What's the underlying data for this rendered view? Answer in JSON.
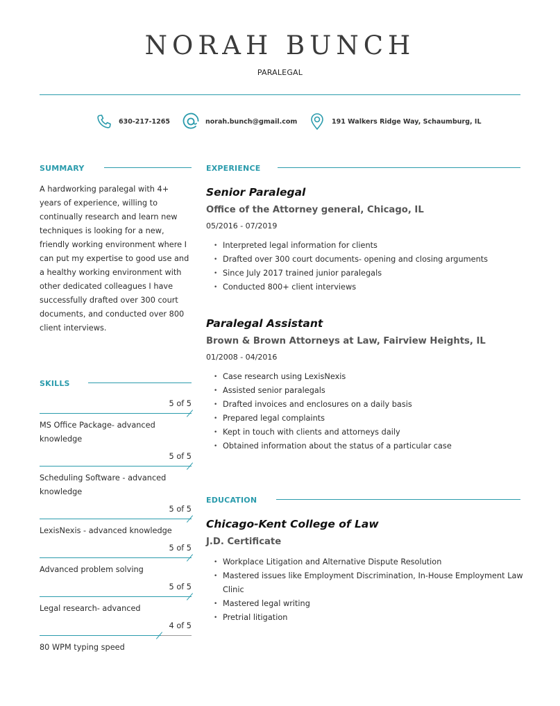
{
  "header": {
    "name": "NORAH BUNCH",
    "title": "PARALEGAL"
  },
  "contact": {
    "phone": {
      "icon": "phone-icon",
      "text": "630-217-1265"
    },
    "email": {
      "icon": "at-sign-icon",
      "text": "norah.bunch@gmail.com"
    },
    "address": {
      "icon": "map-pin-icon",
      "text": "191 Walkers Ridge Way, Schaumburg, IL"
    }
  },
  "colors": {
    "accent": "#2a9bac",
    "text": "#2b2b2b",
    "subtle": "#555555"
  },
  "summary": {
    "heading": "SUMMARY",
    "text": "A hardworking paralegal with 4+ years of experience, willing to continually research and learn new techniques is looking for a new, friendly working environment where I can put my expertise to good use and a healthy working environment with other dedicated colleagues I have successfully drafted over 300 court documents, and conducted over 800 client interviews."
  },
  "skills": {
    "heading": "SKILLS",
    "items": [
      {
        "level_label": "5 of 5",
        "level": 5,
        "max": 5,
        "name": "MS Office Package- advanced knowledge"
      },
      {
        "level_label": "5 of 5",
        "level": 5,
        "max": 5,
        "name": "Scheduling Software - advanced knowledge"
      },
      {
        "level_label": "5 of 5",
        "level": 5,
        "max": 5,
        "name": "LexisNexis - advanced knowledge"
      },
      {
        "level_label": "5 of 5",
        "level": 5,
        "max": 5,
        "name": "Advanced problem solving"
      },
      {
        "level_label": "5 of 5",
        "level": 5,
        "max": 5,
        "name": "Legal research- advanced"
      },
      {
        "level_label": "4 of 5",
        "level": 4,
        "max": 5,
        "name": "80 WPM typing speed"
      }
    ]
  },
  "experience": {
    "heading": "EXPERIENCE",
    "jobs": [
      {
        "title": "Senior Paralegal",
        "org": "Office of the Attorney general, Chicago, IL",
        "dates": "05/2016 - 07/2019",
        "bullets": [
          "Interpreted legal information for clients",
          "Drafted over 300 court documents- opening and closing arguments",
          "Since July 2017 trained junior paralegals",
          "Conducted 800+ client interviews"
        ]
      },
      {
        "title": "Paralegal Assistant",
        "org": "Brown & Brown Attorneys at Law, Fairview Heights, IL",
        "dates": "01/2008 - 04/2016",
        "bullets": [
          "Case research using LexisNexis",
          "Assisted senior paralegals",
          "Drafted invoices and enclosures on a daily basis",
          "Prepared legal complaints",
          "Kept in touch with clients and attorneys daily",
          "Obtained information about the status of a particular case"
        ]
      }
    ]
  },
  "education": {
    "heading": "EDUCATION",
    "school": "Chicago-Kent College of Law",
    "degree": "J.D. Certificate",
    "bullets": [
      "Workplace Litigation and Alternative Dispute Resolution",
      "Mastered issues like Employment Discrimination, In-House Employment Law Clinic",
      "Mastered legal writing",
      "Pretrial litigation"
    ]
  }
}
